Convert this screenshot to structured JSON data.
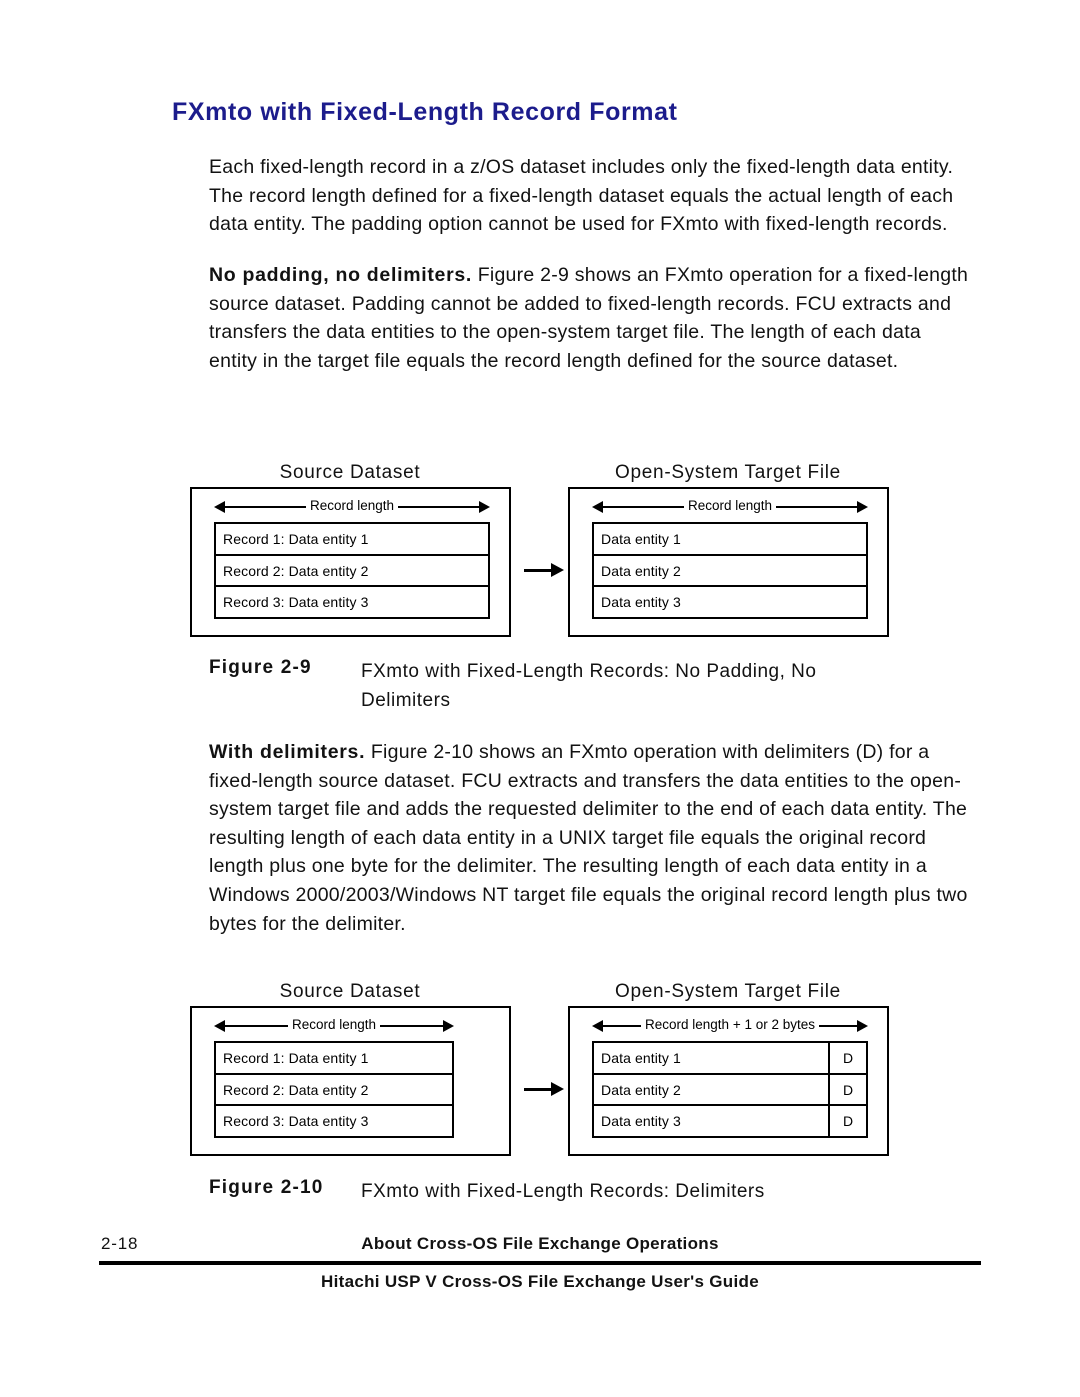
{
  "heading": "FXmto with Fixed-Length Record Format",
  "paragraphs": {
    "p1": "Each fixed-length record in a z/OS dataset includes only the fixed-length data entity. The record length defined for a fixed-length dataset equals the actual length of each data entity. The padding option cannot be used for FXmto with fixed-length records.",
    "p2_lead": "No padding, no delimiters.",
    "p2_rest": " Figure 2-9 shows an FXmto operation for a fixed-length source dataset. Padding cannot be added to fixed-length records. FCU extracts and transfers the data entities to the open-system target file. The length of each data entity in the target file equals the record length defined for the source dataset.",
    "p3_lead": "With delimiters.",
    "p3_rest": " Figure 2-10 shows an FXmto operation with delimiters (D) for a fixed-length source dataset. FCU extracts and transfers the data entities to the open-system target file and adds the requested delimiter to the end of each data entity. The resulting length of each data entity in a UNIX target file equals the original record length plus one byte for the delimiter. The resulting length of each data entity in a Windows 2000/2003/Windows NT target file equals the original record length plus two bytes for the delimiter."
  },
  "figure_1": {
    "source": {
      "label": "Source Dataset",
      "length_label": "Record length",
      "rows": [
        "Record 1: Data entity 1",
        "Record 2: Data entity 2",
        "Record 3: Data entity 3"
      ]
    },
    "target": {
      "label": "Open-System Target File",
      "length_label": "Record length",
      "rows": [
        "Data entity 1",
        "Data entity 2",
        "Data entity 3"
      ]
    },
    "caption_number": "Figure 2-9",
    "caption_title": "FXmto with Fixed-Length Records: No Padding, No Delimiters"
  },
  "figure_2": {
    "source": {
      "label": "Source Dataset",
      "length_label": "Record length",
      "rows": [
        "Record 1: Data entity 1",
        "Record 2: Data entity 2",
        "Record 3: Data entity 3"
      ]
    },
    "target": {
      "label": "Open-System Target File",
      "length_label": "Record length + 1 or 2 bytes",
      "rows": [
        "Data entity 1",
        "Data entity 2",
        "Data entity 3"
      ],
      "delimiters": [
        "D",
        "D",
        "D"
      ]
    },
    "caption_number": "Figure 2-10",
    "caption_title": "FXmto with Fixed-Length Records: Delimiters"
  },
  "footer": {
    "page_number": "2-18",
    "chapter": "About Cross-OS File Exchange Operations",
    "guide": "Hitachi USP V Cross-OS File Exchange User's Guide"
  },
  "colors": {
    "heading": "#1c1c8c",
    "text": "#121212",
    "rule": "#000000"
  }
}
